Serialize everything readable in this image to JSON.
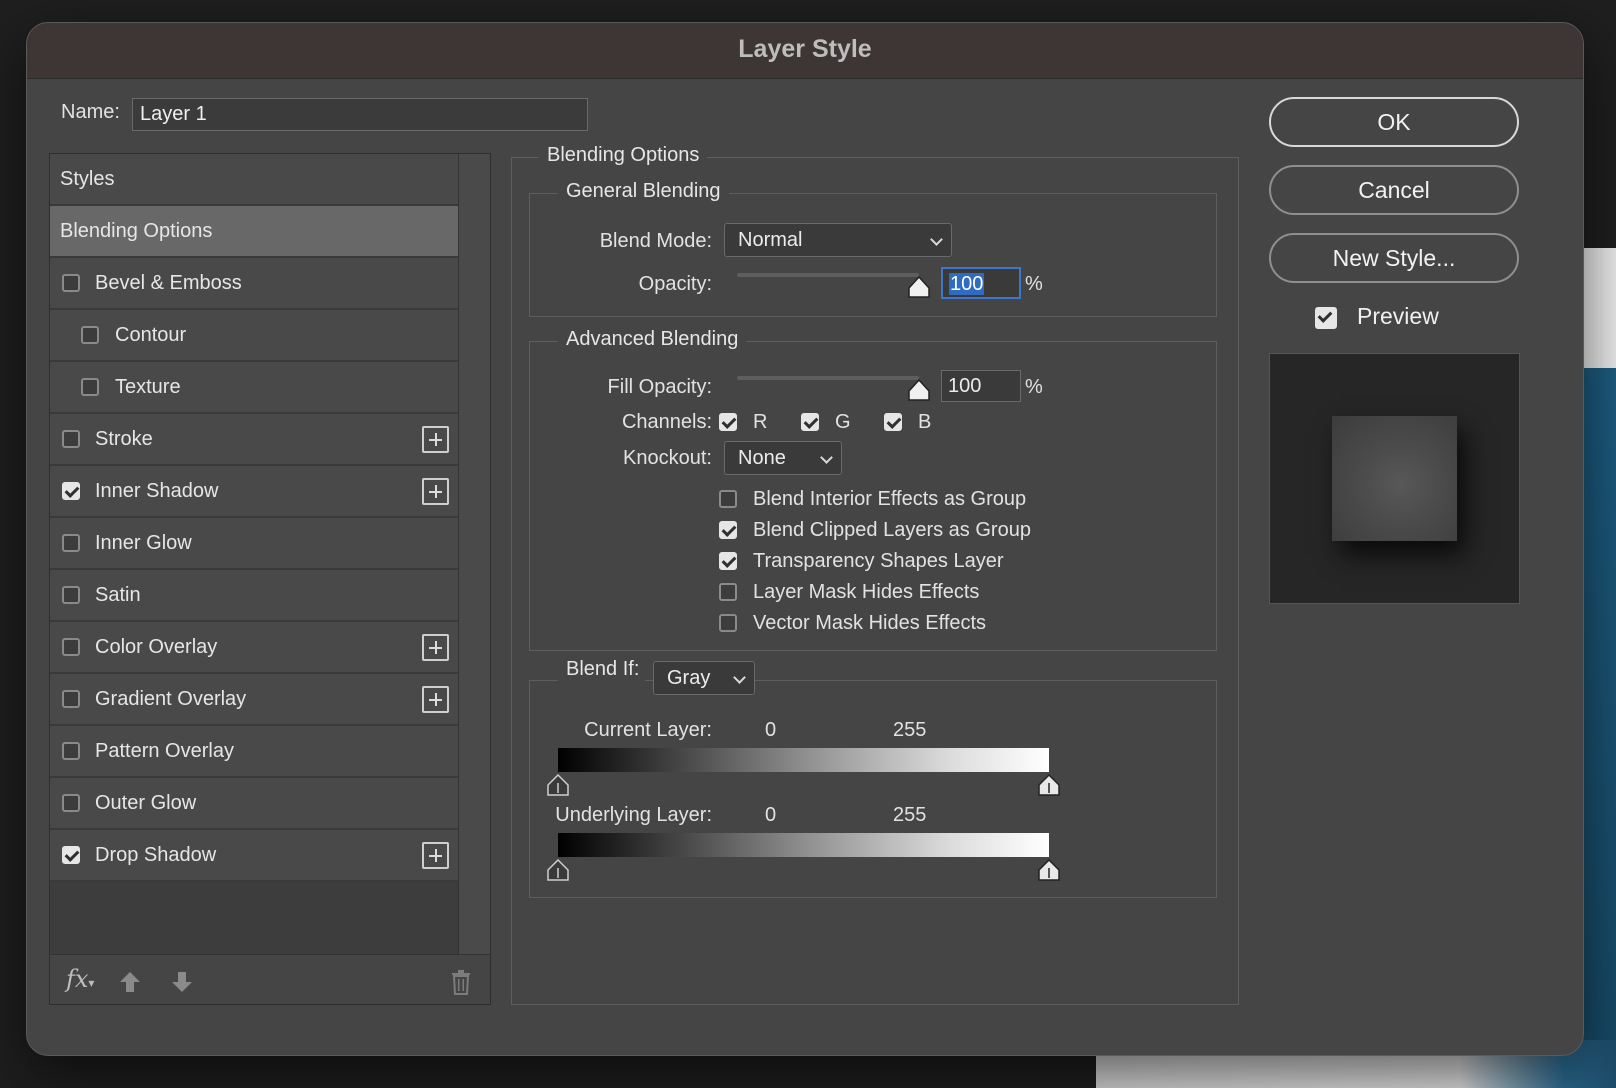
{
  "dialog": {
    "title": "Layer Style"
  },
  "name": {
    "label": "Name:",
    "value": "Layer 1"
  },
  "styles_list": {
    "items": [
      {
        "label": "Styles",
        "checkbox": false,
        "checked": false,
        "plus": false
      },
      {
        "label": "Blending Options",
        "checkbox": false,
        "checked": false,
        "plus": false,
        "selected": true
      },
      {
        "label": "Bevel & Emboss",
        "checkbox": true,
        "checked": false,
        "plus": false
      },
      {
        "label": "Contour",
        "checkbox": true,
        "checked": false,
        "plus": false,
        "sub": true
      },
      {
        "label": "Texture",
        "checkbox": true,
        "checked": false,
        "plus": false,
        "sub": true
      },
      {
        "label": "Stroke",
        "checkbox": true,
        "checked": false,
        "plus": true
      },
      {
        "label": "Inner Shadow",
        "checkbox": true,
        "checked": true,
        "plus": true
      },
      {
        "label": "Inner Glow",
        "checkbox": true,
        "checked": false,
        "plus": false
      },
      {
        "label": "Satin",
        "checkbox": true,
        "checked": false,
        "plus": false
      },
      {
        "label": "Color Overlay",
        "checkbox": true,
        "checked": false,
        "plus": true
      },
      {
        "label": "Gradient Overlay",
        "checkbox": true,
        "checked": false,
        "plus": true
      },
      {
        "label": "Pattern Overlay",
        "checkbox": true,
        "checked": false,
        "plus": false
      },
      {
        "label": "Outer Glow",
        "checkbox": true,
        "checked": false,
        "plus": false
      },
      {
        "label": "Drop Shadow",
        "checkbox": true,
        "checked": true,
        "plus": true
      }
    ],
    "footer": {
      "fx": "fx"
    }
  },
  "blending": {
    "title": "Blending Options",
    "general": {
      "title": "General Blending",
      "blend_mode_label": "Blend Mode:",
      "blend_mode_value": "Normal",
      "opacity_label": "Opacity:",
      "opacity_value": "100",
      "opacity_unit": "%",
      "opacity_level": 100
    },
    "advanced": {
      "title": "Advanced Blending",
      "fill_opacity_label": "Fill Opacity:",
      "fill_opacity_value": "100",
      "fill_opacity_unit": "%",
      "fill_opacity_level": 100,
      "channels_label": "Channels:",
      "channels": [
        {
          "label": "R",
          "checked": true
        },
        {
          "label": "G",
          "checked": true
        },
        {
          "label": "B",
          "checked": true
        }
      ],
      "knockout_label": "Knockout:",
      "knockout_value": "None",
      "options": [
        {
          "label": "Blend Interior Effects as Group",
          "checked": false
        },
        {
          "label": "Blend Clipped Layers as Group",
          "checked": true
        },
        {
          "label": "Transparency Shapes Layer",
          "checked": true
        },
        {
          "label": "Layer Mask Hides Effects",
          "checked": false
        },
        {
          "label": "Vector Mask Hides Effects",
          "checked": false
        }
      ]
    },
    "blend_if": {
      "label": "Blend If:",
      "value": "Gray",
      "current_label": "Current Layer:",
      "current_min": "0",
      "current_max": "255",
      "underlying_label": "Underlying Layer:",
      "underlying_min": "0",
      "underlying_max": "255"
    }
  },
  "buttons": {
    "ok": "OK",
    "cancel": "Cancel",
    "new_style": "New Style..."
  },
  "preview": {
    "label": "Preview",
    "checked": true
  }
}
